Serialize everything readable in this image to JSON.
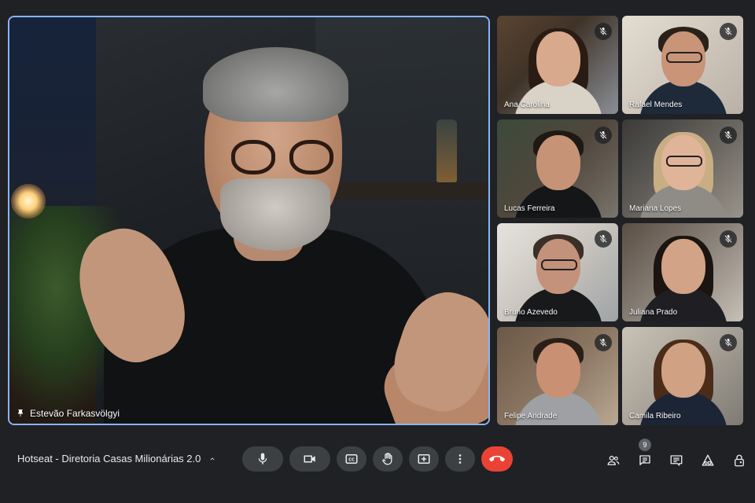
{
  "main_speaker": {
    "name": "Estevão Farkasvölgyi",
    "pinned": true,
    "icons": {
      "pin": "pin-icon"
    }
  },
  "participants": [
    {
      "name": "Ana Carolina",
      "muted": true,
      "icon": "mic-off-icon"
    },
    {
      "name": "Rafael Mendes",
      "muted": true,
      "icon": "mic-off-icon"
    },
    {
      "name": "Lucas Ferreira",
      "muted": true,
      "icon": "mic-off-icon"
    },
    {
      "name": "Mariana Lopes",
      "muted": true,
      "icon": "mic-off-icon"
    },
    {
      "name": "Bruno Azevedo",
      "muted": true,
      "icon": "mic-off-icon"
    },
    {
      "name": "Juliana Prado",
      "muted": true,
      "icon": "mic-off-icon"
    },
    {
      "name": "Felipe Andrade",
      "muted": true,
      "icon": "mic-off-icon"
    },
    {
      "name": "Camila Ribeiro",
      "muted": true,
      "icon": "mic-off-icon"
    }
  ],
  "meeting": {
    "title": "Hotseat - Diretoria Casas Milionárias 2.0",
    "title_icon": "chevron-up-icon"
  },
  "controls": [
    {
      "name": "microphone",
      "icon": "mic-icon"
    },
    {
      "name": "camera",
      "icon": "videocam-icon"
    },
    {
      "name": "captions",
      "icon": "closed-captions-icon"
    },
    {
      "name": "raise-hand",
      "icon": "hand-icon"
    },
    {
      "name": "present",
      "icon": "present-screen-icon"
    },
    {
      "name": "more-options",
      "icon": "more-vert-icon"
    },
    {
      "name": "leave-call",
      "icon": "call-end-icon"
    }
  ],
  "side_panel_buttons": [
    {
      "name": "people",
      "icon": "people-icon"
    },
    {
      "name": "chat",
      "icon": "chat-icon",
      "badge": "9"
    },
    {
      "name": "activities",
      "icon": "comment-icon"
    },
    {
      "name": "tools",
      "icon": "shapes-icon"
    },
    {
      "name": "host-controls",
      "icon": "lock-person-icon"
    }
  ],
  "colors": {
    "background": "#202124",
    "button": "#3c4043",
    "end_call": "#ea4335",
    "speaker_border": "#8ab4f8"
  }
}
